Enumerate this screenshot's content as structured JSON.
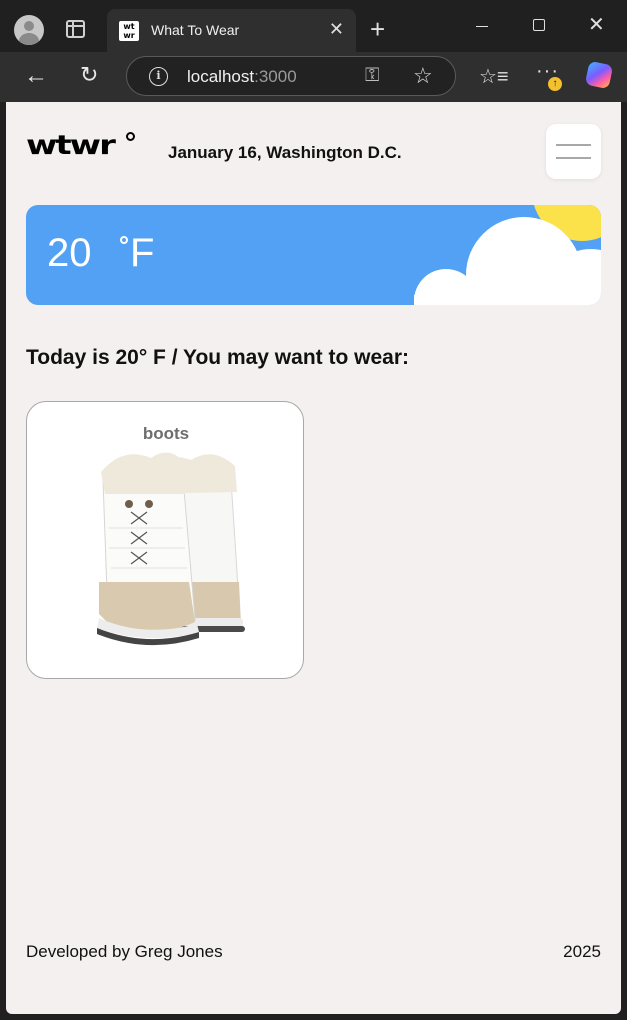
{
  "browser": {
    "tab_title": "What To Wear",
    "favicon_text": "wt wr",
    "url_host": "localhost",
    "url_port": ":3000"
  },
  "header": {
    "logo": "wtwr",
    "date_location": "January 16, Washington D.C."
  },
  "weather": {
    "temperature": "20",
    "unit": "F",
    "condition": "cloudy-day",
    "card_color": "#52a1f4"
  },
  "main": {
    "heading": "Today is 20° F / You may want to wear:",
    "items": [
      {
        "name": "boots"
      }
    ]
  },
  "footer": {
    "developer": "Developed by Greg Jones",
    "year": "2025"
  },
  "colors": {
    "page_bg": "#f4f0f0",
    "sun": "#fbe14a"
  }
}
